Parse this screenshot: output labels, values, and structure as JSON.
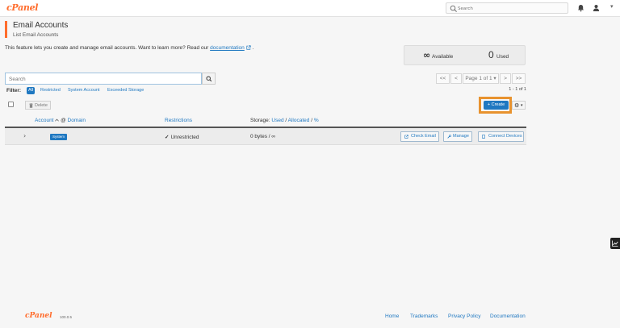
{
  "header": {
    "logo": "cPanel",
    "search_placeholder": "Search"
  },
  "page": {
    "title": "Email Accounts",
    "subtitle": "List Email Accounts",
    "description": "This feature lets you create and manage email accounts. Want to learn more? Read our",
    "doc_link": "documentation",
    "doc_suffix": "."
  },
  "stats": {
    "available_symbol": "∞",
    "available_label": "Available",
    "used_value": "0",
    "used_label": "Used"
  },
  "search": {
    "placeholder": "Search"
  },
  "pagination": {
    "first": "<<",
    "prev": "<",
    "page_label": "Page 1 of 1",
    "next": ">",
    "last": ">>",
    "count": "1 - 1 of 1"
  },
  "filter": {
    "label": "Filter:",
    "options": [
      "All",
      "Restricted",
      "System Account",
      "Exceeded Storage"
    ],
    "selected": "All"
  },
  "toolbar": {
    "delete_label": "Delete",
    "create_label": "+ Create"
  },
  "table": {
    "columns": {
      "account": "Account",
      "at_symbol": "@",
      "domain": "Domain",
      "restrictions": "Restrictions",
      "storage_prefix": "Storage:",
      "storage_used": "Used",
      "storage_allocated": "Allocated",
      "storage_percent": "%",
      "separator": "/"
    },
    "rows": [
      {
        "badge": "System",
        "restrictions": "Unrestricted",
        "storage": "0 bytes / ∞",
        "actions": [
          "Check Email",
          "Manage",
          "Connect Devices"
        ]
      }
    ]
  },
  "footer": {
    "logo": "cPanel",
    "version": "100.0.5",
    "links": [
      "Home",
      "Trademarks",
      "Privacy Policy",
      "Documentation"
    ]
  },
  "colors": {
    "brand": "#ff6c2c",
    "link": "#1f78c1",
    "highlight": "#e8922e"
  }
}
